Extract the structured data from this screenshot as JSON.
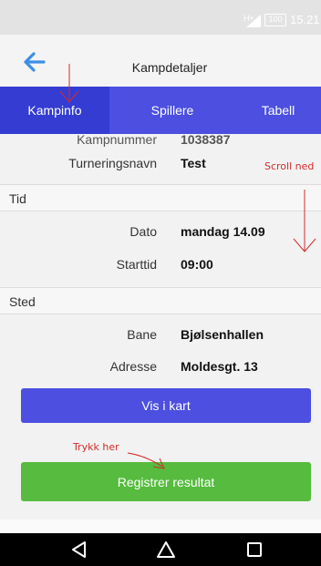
{
  "status_bar": {
    "signal_label": "H+",
    "battery": "100",
    "time": "15.21"
  },
  "header": {
    "title": "Kampdetaljer",
    "back_icon": "arrow-left-icon",
    "accent_color": "#3c8ee6"
  },
  "tabs": [
    {
      "label": "Kampinfo",
      "active": true
    },
    {
      "label": "Spillere",
      "active": false
    },
    {
      "label": "Tabell",
      "active": false
    }
  ],
  "details": {
    "cut_row": {
      "label": "Kampnummer",
      "value": "1038387"
    },
    "tournament": {
      "label": "Turneringsnavn",
      "value": "Test"
    },
    "time_section": "Tid",
    "date": {
      "label": "Dato",
      "value": "mandag 14.09"
    },
    "start": {
      "label": "Starttid",
      "value": "09:00"
    },
    "place_section": "Sted",
    "venue": {
      "label": "Bane",
      "value": "Bjølsenhallen"
    },
    "address": {
      "label": "Adresse",
      "value": "Moldesgt. 13"
    }
  },
  "buttons": {
    "map": "Vis i kart",
    "register": "Registrer resultat"
  },
  "annotations": {
    "scroll": "Scroll ned",
    "tap": "Trykk her"
  },
  "colors": {
    "tab_bar": "#4c4fe0",
    "tab_active": "#343cd2",
    "register_button": "#56bb3e",
    "annotation": "#d42a2a"
  },
  "nav_icons": [
    "back-triangle-icon",
    "home-icon",
    "recents-square-icon"
  ]
}
